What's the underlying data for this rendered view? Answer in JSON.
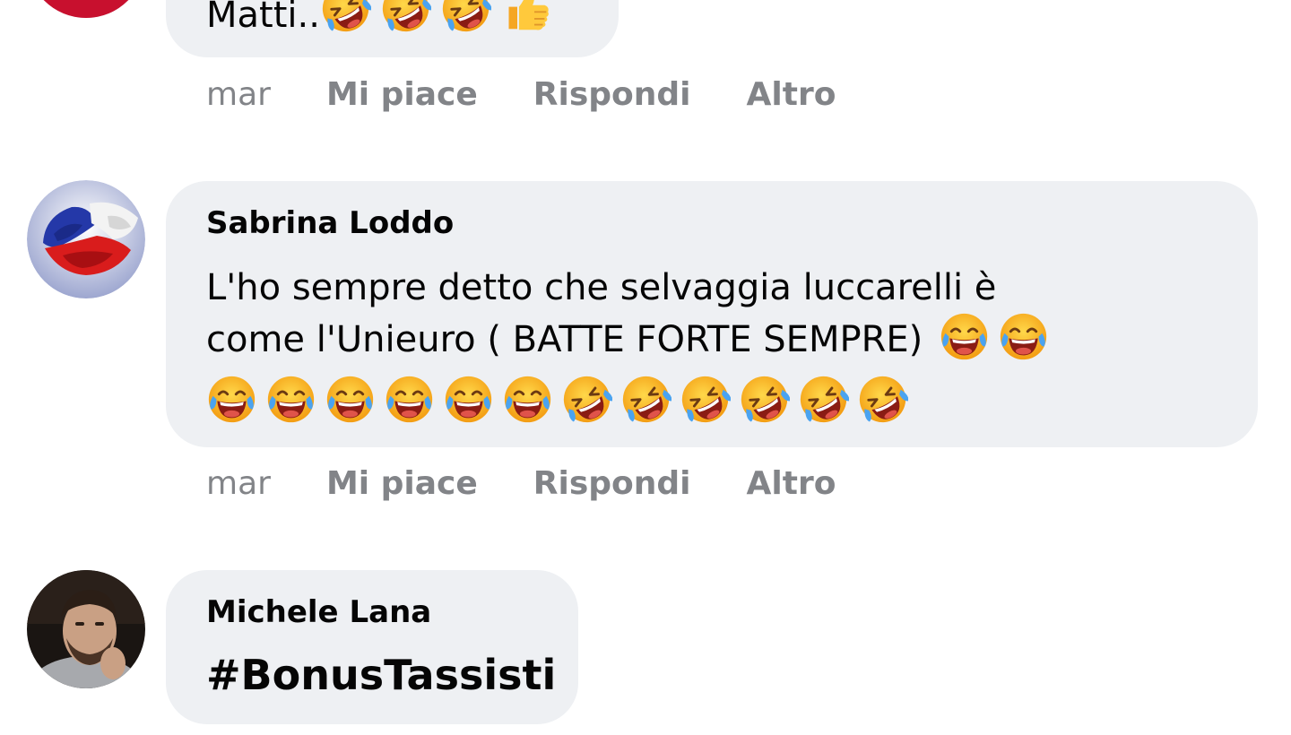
{
  "comments": [
    {
      "author": "",
      "text": "Matti..",
      "emojis": [
        "rofl",
        "rofl",
        "rofl",
        "thumbs-up"
      ],
      "actions": {
        "time": "mar",
        "like": "Mi piace",
        "reply": "Rispondi",
        "more": "Altro"
      }
    },
    {
      "author": "Sabrina Loddo",
      "text_line1": "L'ho sempre detto che selvaggia luccarelli è",
      "text_line2": "come l'Unieuro ( BATTE FORTE SEMPRE)",
      "emojis_inline": [
        "joy",
        "joy"
      ],
      "emojis_row": [
        "joy",
        "joy",
        "joy",
        "joy",
        "joy",
        "joy",
        "rofl",
        "rofl",
        "rofl",
        "rofl",
        "rofl",
        "rofl"
      ],
      "actions": {
        "time": "mar",
        "like": "Mi piace",
        "reply": "Rispondi",
        "more": "Altro"
      }
    },
    {
      "author": "Michele Lana",
      "text": "#BonusTassisti"
    }
  ],
  "colors": {
    "bubble": "#eef0f3",
    "action_text": "#828488",
    "text": "#050505"
  }
}
